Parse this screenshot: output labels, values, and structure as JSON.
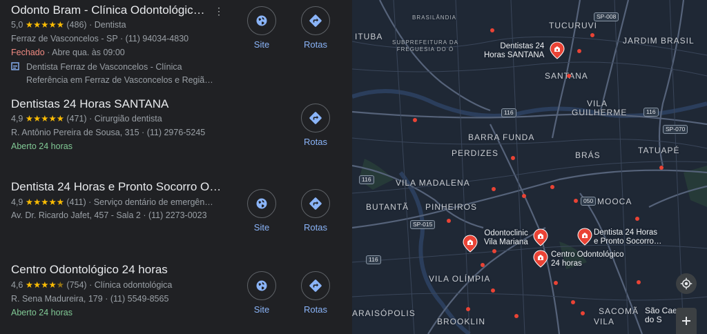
{
  "results": [
    {
      "title": "Odonto Bram - Clínica Odontológic…",
      "rating": "5,0",
      "stars": "★★★★★",
      "reviews": "(486)",
      "category": "Dentista",
      "address": "Ferraz de Vasconcelos - SP",
      "phone": "(11) 94034-4830",
      "status": "Fechado",
      "status_extra": "Abre qua. às 09:00",
      "business_line1": "Dentista Ferraz de Vasconcelos - Clínica",
      "business_line2": "Referência em Ferraz de Vasconcelos e Regiã…",
      "site_label": "Site",
      "routes_label": "Rotas"
    },
    {
      "title": "Dentistas 24 Horas SANTANA",
      "rating": "4,9",
      "stars": "★★★★★",
      "reviews": "(471)",
      "category": "Cirurgião dentista",
      "address": "R. Antônio Pereira de Sousa, 315",
      "phone": "(11) 2976-5245",
      "status": "Aberto 24 horas",
      "routes_label": "Rotas"
    },
    {
      "title": "Dentista 24 Horas e Pronto Socorro Od…",
      "rating": "4,9",
      "stars": "★★★★★",
      "reviews": "(411)",
      "category": "Serviço dentário de emergên…",
      "address": "Av. Dr. Ricardo Jafet, 457 - Sala 2",
      "phone": "(11) 2273-0023",
      "site_label": "Site",
      "routes_label": "Rotas"
    },
    {
      "title": "Centro Odontológico 24 horas",
      "rating": "4,6",
      "stars": "★★★★",
      "half_star": "★",
      "reviews": "(754)",
      "category": "Clínica odontológica",
      "address": "R. Sena Madureira, 179",
      "phone": "(11) 5549-8565",
      "status": "Aberto 24 horas",
      "site_label": "Site",
      "routes_label": "Rotas"
    }
  ],
  "separator": "·",
  "map": {
    "areas": {
      "brasilandia": "BRASILÂNDIA",
      "tucuruvi": "TUCURUVI",
      "jardim_brasil": "JARDIM BRASIL",
      "ituba": "ITUBA",
      "subprefeitura_1": "SUBPREFEITURA DA",
      "subprefeitura_2": "FREGUESIA DO Ó",
      "santana": "SANTANA",
      "vila_guilherme_1": "VILA",
      "vila_guilherme_2": "GUILHERME",
      "barra_funda": "BARRA FUNDA",
      "perdizes": "PERDIZES",
      "bras": "BRÁS",
      "tatuape": "TATUAPÉ",
      "vila_madalena": "VILA MADALENA",
      "butanta": "BUTANTÃ",
      "pinheiros": "PINHEIROS",
      "mooca": "MOOCA",
      "vila_olimpia": "VILA OLÍMPIA",
      "araisopolis": "ARAISÓPOLIS",
      "brooklin": "BROOKLIN",
      "sacoma": "SACOMÃ",
      "vila_cut": "VILA",
      "sao_caetano_1": "São Cae",
      "sao_caetano_2": "do S"
    },
    "shields": {
      "sp008": "SP-008",
      "r116a": "116",
      "r116b": "116",
      "sp070": "SP-070",
      "r116c": "116",
      "r050": "050",
      "sp015": "SP-015",
      "r116d": "116"
    },
    "places": {
      "santana_1": "Dentistas 24",
      "santana_2": "Horas SANTANA",
      "odontoclinic_1": "Odontoclinic",
      "odontoclinic_2": "Vila Mariana",
      "pronto_1": "Dentista 24 Horas",
      "pronto_2": "e Pronto Socorro…",
      "centro_1": "Centro Odontológico",
      "centro_2": "24 horas"
    },
    "colors": {
      "pin": "#ea4335",
      "map_bg": "#1f2835",
      "road": "#3d4a5f",
      "water": "#17263c"
    },
    "icons": [
      "location-icon",
      "zoom-in-icon",
      "globe-icon",
      "directions-icon",
      "business-icon"
    ]
  }
}
